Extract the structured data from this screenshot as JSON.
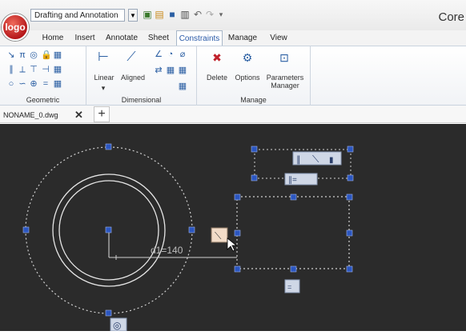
{
  "app": {
    "title": "Core",
    "logo": "logo"
  },
  "workspace": {
    "selected": "Drafting and Annotation"
  },
  "quick_access": {
    "icons": [
      "new-file-icon",
      "open-file-icon",
      "save-icon",
      "print-icon",
      "undo-icon",
      "redo-icon",
      "more-icon"
    ]
  },
  "tabs": [
    "Home",
    "Insert",
    "Annotate",
    "Sheet",
    "Constraints",
    "Manage",
    "View"
  ],
  "active_tab": "Constraints",
  "ribbon": {
    "geometric_label": "Geometric",
    "dimensional_label": "Dimensional",
    "linear_label": "Linear",
    "aligned_label": "Aligned",
    "manage_label": "Manage",
    "delete_label": "Delete",
    "options_label": "Options",
    "parameters_label_1": "Parameters",
    "parameters_label_2": "Manager"
  },
  "document": {
    "tab": "NONAME_0.dwg",
    "close": "✕",
    "add": "+"
  },
  "drawing": {
    "dimension_text": "d1=140"
  },
  "colors": {
    "canvas": "#2b2b2b",
    "grip": "#2b56c0",
    "accent_tab": "#2a5aa8"
  }
}
